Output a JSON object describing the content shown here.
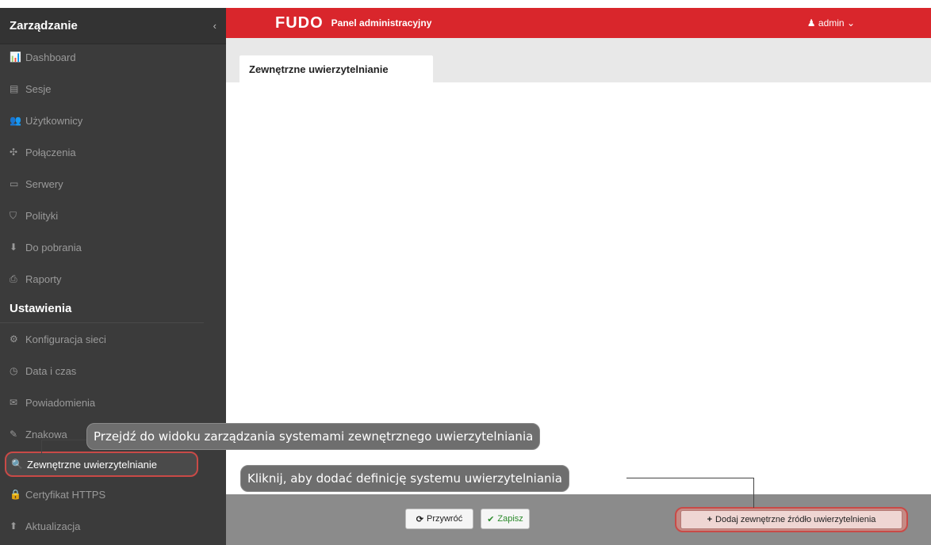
{
  "sidebar": {
    "title": "Zarządzanie",
    "collapse_icon": "‹",
    "items": [
      {
        "icon": "📊",
        "label": "Dashboard"
      },
      {
        "icon": "▤",
        "label": "Sesje"
      },
      {
        "icon": "👥",
        "label": "Użytkownicy"
      },
      {
        "icon": "✣",
        "label": "Połączenia"
      },
      {
        "icon": "▭",
        "label": "Serwery"
      },
      {
        "icon": "⛉",
        "label": "Polityki"
      },
      {
        "icon": "⬇",
        "label": "Do pobrania"
      },
      {
        "icon": "⎙",
        "label": "Raporty"
      }
    ],
    "section_title": "Ustawienia",
    "settings_items": [
      {
        "icon": "⚙",
        "label": "Konfiguracja sieci"
      },
      {
        "icon": "◷",
        "label": "Data i czas"
      },
      {
        "icon": "✉",
        "label": "Powiadomienia"
      },
      {
        "icon": "✎",
        "label": "Znakowa"
      },
      {
        "icon": "🔍",
        "label": "Zewnętrzne uwierzytelnianie"
      },
      {
        "icon": "🔒",
        "label": "Certyfikat HTTPS"
      },
      {
        "icon": "⬆",
        "label": "Aktualizacja"
      }
    ]
  },
  "topbar": {
    "logo": "FUDO",
    "panel_title": "Panel administracyjny",
    "user": "admin",
    "user_icon": "♟",
    "user_chevron": "⌄"
  },
  "tab": {
    "label": "Zewnętrzne uwierzytelnianie"
  },
  "footer": {
    "restore_icon": "⟳",
    "restore_label": "Przywróć",
    "save_icon": "✔",
    "save_label": "Zapisz",
    "add_icon": "+",
    "add_label": "Dodaj zewnętrzne źródło uwierzytelnienia"
  },
  "callouts": {
    "go_to_view": "Przejdź do widoku zarządzania systemami zewnętrznego uwierzytelniania",
    "click_add": "Kliknij, aby dodać definicję systemu uwierzytelniania"
  },
  "colors": {
    "brand_red": "#d9262c",
    "sidebar_bg": "#3b3b3b",
    "highlight": "#c94a47"
  }
}
